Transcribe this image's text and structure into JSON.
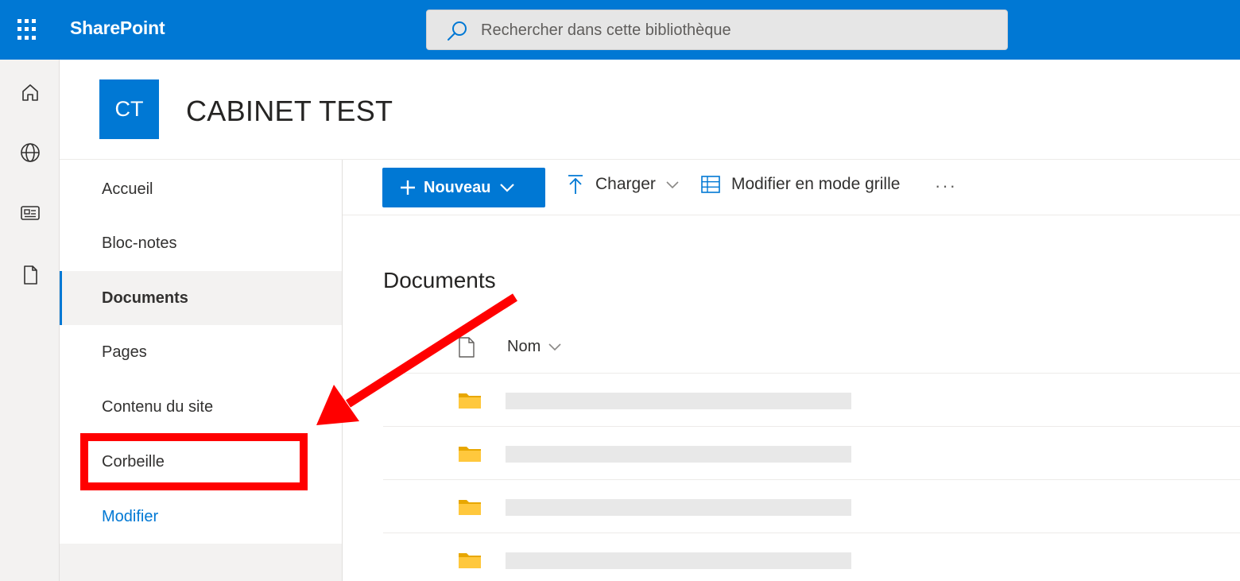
{
  "app": {
    "name": "SharePoint"
  },
  "search": {
    "placeholder": "Rechercher dans cette bibliothèque"
  },
  "apprail": {
    "icons": [
      "home-icon",
      "globe-icon",
      "news-icon",
      "document-icon"
    ]
  },
  "site": {
    "logo_initials": "CT",
    "title": "CABINET TEST"
  },
  "leftnav": {
    "items": [
      {
        "label": "Accueil"
      },
      {
        "label": "Bloc-notes"
      },
      {
        "label": "Documents",
        "selected": true
      },
      {
        "label": "Pages"
      },
      {
        "label": "Contenu du site"
      },
      {
        "label": "Corbeille"
      }
    ],
    "edit_link": "Modifier"
  },
  "commandbar": {
    "new_label": "Nouveau",
    "upload_label": "Charger",
    "grid_label": "Modifier en mode grille",
    "more_label": "···"
  },
  "library": {
    "title": "Documents",
    "column_name": "Nom",
    "rows": [
      {
        "type": "folder"
      },
      {
        "type": "folder"
      },
      {
        "type": "folder"
      },
      {
        "type": "folder"
      }
    ]
  },
  "colors": {
    "accent": "#0078d4",
    "annotation": "#ff0000",
    "folder": "#ffb900"
  }
}
